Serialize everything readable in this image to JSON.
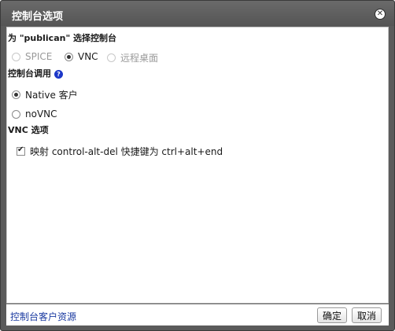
{
  "dialog": {
    "title": "控制台选项",
    "close_icon": "close-icon",
    "close_glyph": "✕"
  },
  "console_select": {
    "label": "为 \"publican\" 选择控制台",
    "options": [
      {
        "label": "SPICE",
        "checked": false,
        "disabled": true
      },
      {
        "label": "VNC",
        "checked": true,
        "disabled": false
      },
      {
        "label": "远程桌面",
        "checked": false,
        "disabled": true
      }
    ]
  },
  "console_invocation": {
    "label": "控制台调用",
    "help_icon": "help-icon",
    "help_glyph": "?",
    "options": [
      {
        "label": "Native 客户",
        "checked": true
      },
      {
        "label": "noVNC",
        "checked": false
      }
    ]
  },
  "vnc_options": {
    "label": "VNC 选项",
    "map_cad_label": "映射 control-alt-del 快捷键为 ctrl+alt+end",
    "map_cad_checked": true
  },
  "footer": {
    "link_label": "控制台客户资源",
    "ok_label": "确定",
    "cancel_label": "取消"
  }
}
